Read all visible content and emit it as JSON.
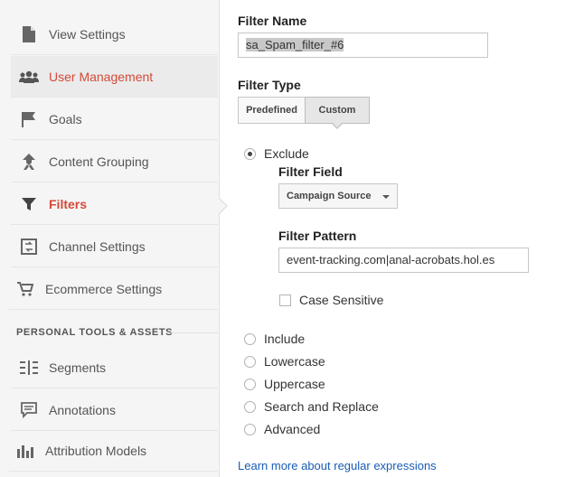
{
  "sidebar": {
    "items": [
      {
        "label": "View Settings",
        "icon": "document-icon"
      },
      {
        "label": "User Management",
        "icon": "users-icon"
      },
      {
        "label": "Goals",
        "icon": "flag-icon"
      },
      {
        "label": "Content Grouping",
        "icon": "content-grouping-icon"
      },
      {
        "label": "Filters",
        "icon": "funnel-icon"
      },
      {
        "label": "Channel Settings",
        "icon": "channel-settings-icon"
      },
      {
        "label": "Ecommerce Settings",
        "icon": "cart-icon"
      }
    ],
    "section_heading": "PERSONAL TOOLS & ASSETS",
    "tools": [
      {
        "label": "Segments",
        "icon": "segments-icon"
      },
      {
        "label": "Annotations",
        "icon": "annotation-icon"
      },
      {
        "label": "Attribution Models",
        "icon": "bar-chart-icon"
      }
    ]
  },
  "form": {
    "filter_name_label": "Filter Name",
    "filter_name_value": "sa_Spam_filter_#6",
    "filter_type_label": "Filter Type",
    "type_tabs": [
      "Predefined",
      "Custom"
    ],
    "selected_type": "Custom",
    "options": [
      "Exclude",
      "Include",
      "Lowercase",
      "Uppercase",
      "Search and Replace",
      "Advanced"
    ],
    "selected_option": "Exclude",
    "filter_field_label": "Filter Field",
    "filter_field_value": "Campaign Source",
    "filter_pattern_label": "Filter Pattern",
    "filter_pattern_value": "event-tracking.com|anal-acrobats.hol.es",
    "case_sensitive_label": "Case Sensitive",
    "learn_more": "Learn more about regular expressions"
  },
  "colors": {
    "accent": "#d64937",
    "link": "#1a5bb5"
  }
}
